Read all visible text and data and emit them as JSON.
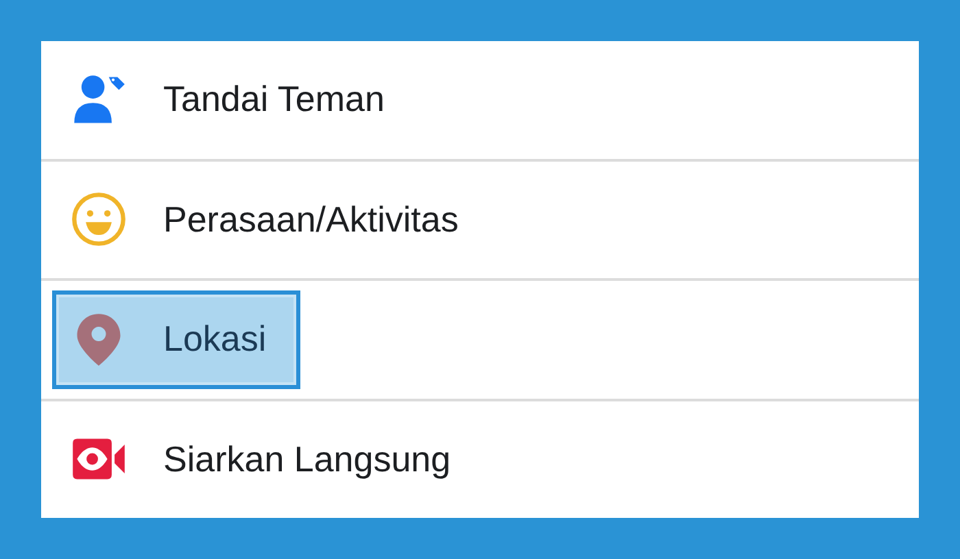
{
  "menu_items": [
    {
      "kind": "tag",
      "label": "Tandai Teman",
      "selected": false
    },
    {
      "kind": "feeling",
      "label": "Perasaan/Aktivitas",
      "selected": false
    },
    {
      "kind": "location",
      "label": "Lokasi",
      "selected": true
    },
    {
      "kind": "live",
      "label": "Siarkan Langsung",
      "selected": false
    }
  ]
}
